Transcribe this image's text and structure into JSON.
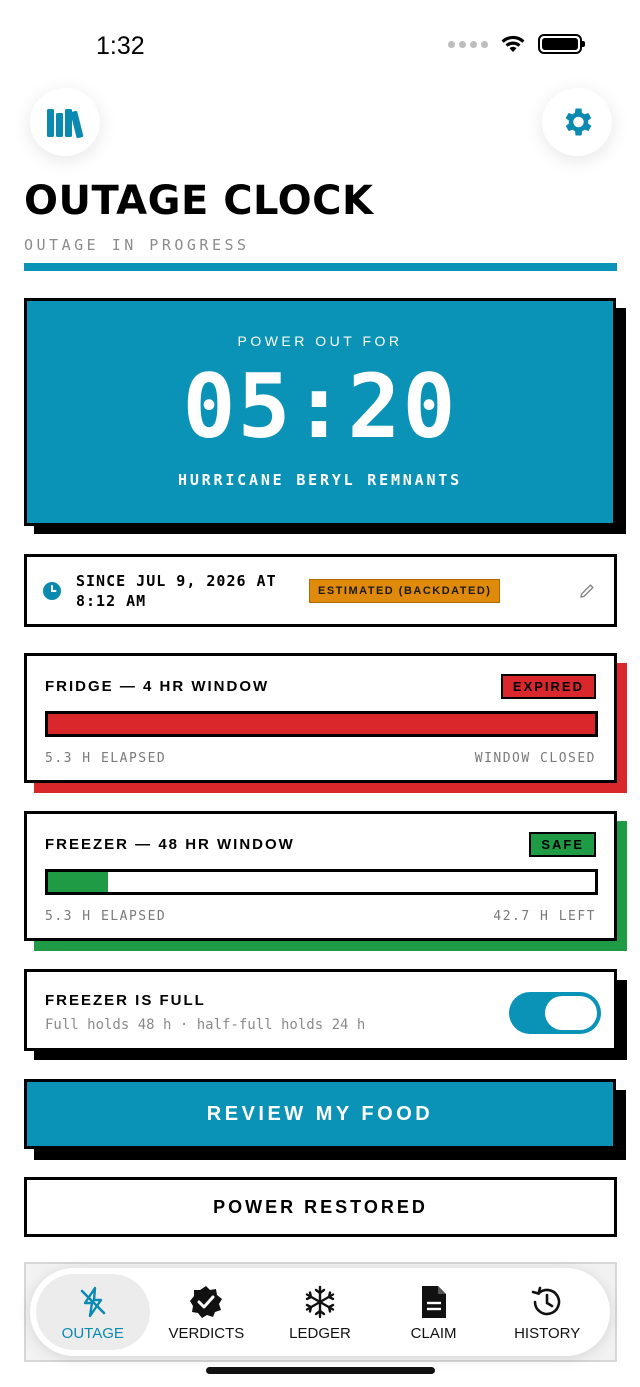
{
  "status_bar": {
    "time": "1:32"
  },
  "header": {
    "title": "OUTAGE CLOCK",
    "subtitle": "OUTAGE IN PROGRESS",
    "left_icon": "library-icon",
    "right_icon": "gear-icon",
    "accent": "#0a93b6"
  },
  "timer": {
    "label": "POWER OUT FOR",
    "value": "05:20",
    "event": "HURRICANE BERYL REMNANTS"
  },
  "since": {
    "text": "SINCE JUL 9, 2026 AT 8:12 AM",
    "badge": "ESTIMATED (BACKDATED)",
    "badge_color": "#e08a0b"
  },
  "windows": [
    {
      "title": "FRIDGE — 4 HR WINDOW",
      "status": "EXPIRED",
      "status_color": "#d9272c",
      "progress": 1.0,
      "left_text": "5.3 H ELAPSED",
      "right_text": "WINDOW CLOSED"
    },
    {
      "title": "FREEZER — 48 HR WINDOW",
      "status": "SAFE",
      "status_color": "#1f9b45",
      "progress": 0.11,
      "left_text": "5.3 H ELAPSED",
      "right_text": "42.7 H LEFT"
    }
  ],
  "freezer_toggle": {
    "title": "FREEZER IS FULL",
    "subtitle": "Full holds 48 h · half-full holds 24 h",
    "on": true
  },
  "actions": {
    "review": "REVIEW MY FOOD",
    "restored": "POWER RESTORED"
  },
  "tabs": [
    {
      "label": "OUTAGE",
      "icon": "lightning-off-icon",
      "active": true
    },
    {
      "label": "VERDICTS",
      "icon": "verified-badge-icon",
      "active": false
    },
    {
      "label": "LEDGER",
      "icon": "snowflake-icon",
      "active": false
    },
    {
      "label": "CLAIM",
      "icon": "document-icon",
      "active": false
    },
    {
      "label": "HISTORY",
      "icon": "history-icon",
      "active": false
    }
  ]
}
